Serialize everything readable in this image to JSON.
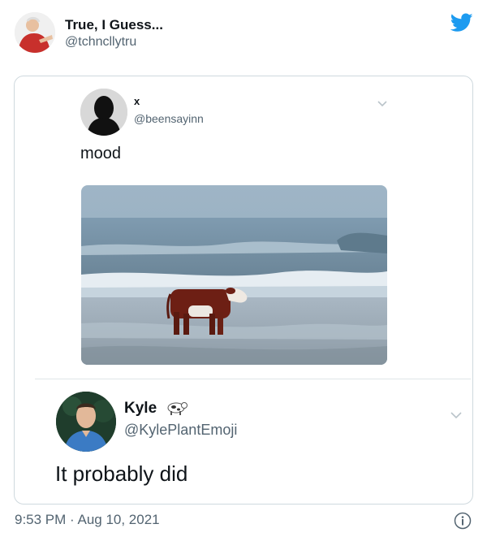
{
  "tweet": {
    "author_name": "True, I Guess...",
    "author_handle": "@tchncllytru",
    "timestamp": "9:53 PM · Aug 10, 2021",
    "icons": {
      "logo": "twitter-bird-icon",
      "info": "info-icon"
    },
    "accent_color": "#1d9bf0"
  },
  "quoted_tweet": {
    "author_name": "x",
    "author_handle": "@beensayinn",
    "text": "mood",
    "media": "cow-on-beach-image",
    "icons": {
      "menu": "chevron-down-icon"
    }
  },
  "reply": {
    "author_name": "Kyle",
    "author_emoji": "cow-emoji",
    "author_handle": "@KylePlantEmoji",
    "text": "It probably did",
    "icons": {
      "menu": "chevron-down-icon"
    }
  }
}
